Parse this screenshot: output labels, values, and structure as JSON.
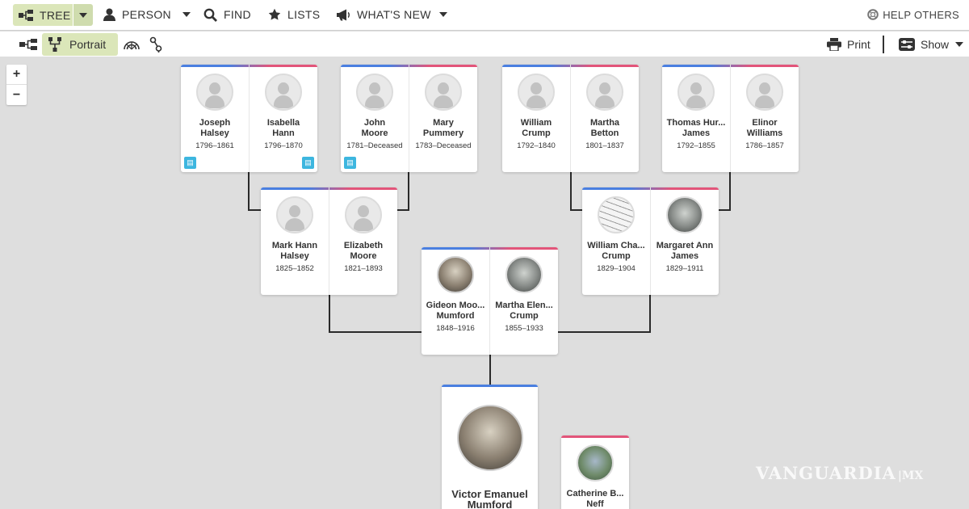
{
  "nav": {
    "tree": "TREE",
    "person": "PERSON",
    "find": "FIND",
    "lists": "LISTS",
    "whats_new": "WHAT'S NEW",
    "help": "HELP OTHERS"
  },
  "toolbar": {
    "portrait": "Portrait",
    "print": "Print",
    "show": "Show"
  },
  "zoom": {
    "plus": "+",
    "minus": "−"
  },
  "couples": [
    {
      "id": "halsey-hann",
      "people": [
        {
          "name": "Joseph Halsey",
          "line1": "Joseph",
          "line2": "Halsey",
          "dates": "1796–1861",
          "badge": true
        },
        {
          "name": "Isabella Hann",
          "line1": "Isabella",
          "line2": "Hann",
          "dates": "1796–1870",
          "badge": true
        }
      ]
    },
    {
      "id": "moore-pummery",
      "people": [
        {
          "name": "John Moore",
          "line1": "John",
          "line2": "Moore",
          "dates": "1781–Deceased",
          "badge": true
        },
        {
          "name": "Mary Pummery",
          "line1": "Mary",
          "line2": "Pummery",
          "dates": "1783–Deceased",
          "badge": false
        }
      ]
    },
    {
      "id": "crump-betton",
      "people": [
        {
          "name": "William Crump",
          "line1": "William",
          "line2": "Crump",
          "dates": "1792–1840"
        },
        {
          "name": "Martha Betton",
          "line1": "Martha",
          "line2": "Betton",
          "dates": "1801–1837"
        }
      ]
    },
    {
      "id": "james-williams",
      "people": [
        {
          "name": "Thomas Hur... James",
          "line1": "Thomas Hur...",
          "line2": "James",
          "dates": "1792–1855"
        },
        {
          "name": "Elinor Williams",
          "line1": "Elinor",
          "line2": "Williams",
          "dates": "1786–1857"
        }
      ]
    },
    {
      "id": "halsey-moore",
      "people": [
        {
          "name": "Mark Hann Halsey",
          "line1": "Mark Hann",
          "line2": "Halsey",
          "dates": "1825–1852"
        },
        {
          "name": "Elizabeth Moore",
          "line1": "Elizabeth",
          "line2": "Moore",
          "dates": "1821–1893"
        }
      ]
    },
    {
      "id": "crump-james",
      "people": [
        {
          "name": "William Cha... Crump",
          "line1": "William Cha...",
          "line2": "Crump",
          "dates": "1829–1904"
        },
        {
          "name": "Margaret Ann James",
          "line1": "Margaret Ann",
          "line2": "James",
          "dates": "1829–1911"
        }
      ]
    },
    {
      "id": "mumford-crump",
      "people": [
        {
          "name": "Gideon Moo... Mumford",
          "line1": "Gideon Moo...",
          "line2": "Mumford",
          "dates": "1848–1916"
        },
        {
          "name": "Martha Elen... Crump",
          "line1": "Martha Elen...",
          "line2": "Crump",
          "dates": "1855–1933"
        }
      ]
    }
  ],
  "focus": {
    "line1": "Victor Emanuel",
    "line2": "Mumford"
  },
  "spouse": {
    "line1": "Catherine B...",
    "line2": "Neff"
  },
  "watermark": "VANGUARDIA",
  "watermark_suffix": "|MX",
  "colors": {
    "male": "#4a7fe0",
    "female": "#e2557a",
    "active": "#dbe6b9",
    "badge": "#3db6df"
  }
}
